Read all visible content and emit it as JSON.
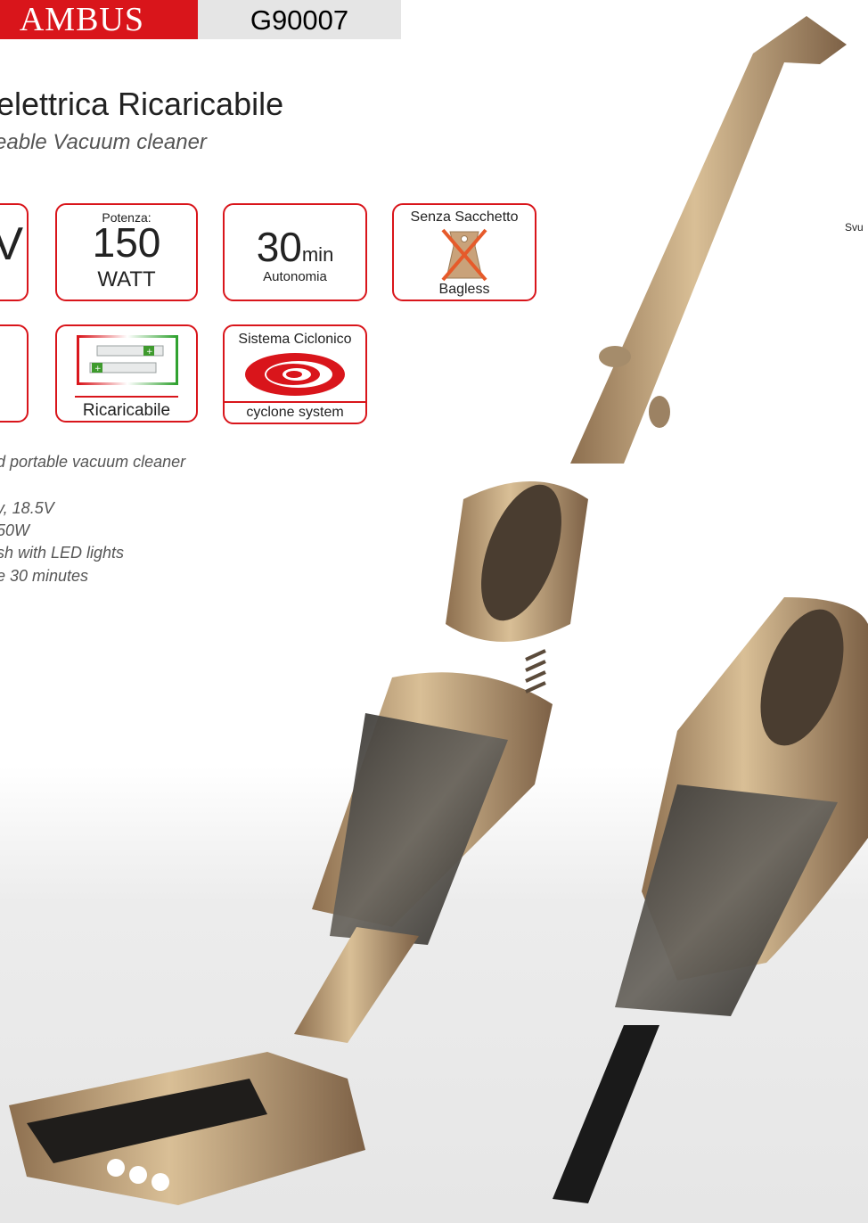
{
  "header": {
    "brand": "AMBUS",
    "model_code": "G90007"
  },
  "title": "elettrica Ricaricabile",
  "subtitle": "eable Vacuum cleaner",
  "badges": {
    "power_label": "Potenza:",
    "power_value": "150",
    "power_unit": "WATT",
    "autonomy_value": "30",
    "autonomy_unit": "min",
    "autonomy_label": "Autonomia",
    "bagless_it": "Senza Sacchetto",
    "bagless_en": "Bagless",
    "rechargeable_label": "Ricaricabile",
    "cyclone_it": "Sistema Ciclonico",
    "cyclone_en": "cyclone system"
  },
  "partial_left": {
    "box1_text": "V"
  },
  "features": [
    "d portable vacuum cleaner",
    "y, 18.5V",
    "50W",
    "sh with LED lights",
    "e 30 minutes"
  ],
  "right_edge_text": "Svu",
  "colors": {
    "brand_red": "#d9151b",
    "product_gold": "#c9a87b"
  }
}
